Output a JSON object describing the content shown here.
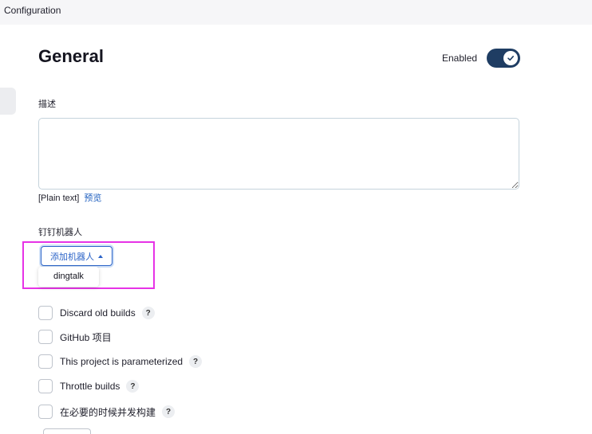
{
  "header": {
    "title": "Configuration"
  },
  "section": {
    "title": "General",
    "enabled_label": "Enabled",
    "enabled": true
  },
  "description": {
    "label": "描述",
    "value": "",
    "plain_text": "[Plain text]",
    "preview_link": "预览"
  },
  "dingtalk": {
    "label": "钉钉机器人",
    "add_button": "添加机器人",
    "dropdown_items": [
      "dingtalk"
    ]
  },
  "options": [
    {
      "label": "Discard old builds",
      "checked": false,
      "help": true
    },
    {
      "label": "GitHub 项目",
      "checked": false,
      "help": false
    },
    {
      "label": "This project is parameterized",
      "checked": false,
      "help": true
    },
    {
      "label": "Throttle builds",
      "checked": false,
      "help": true
    },
    {
      "label": "在必要的时候并发构建",
      "checked": false,
      "help": true
    }
  ],
  "help_glyph": "?",
  "colors": {
    "accent": "#2c64c8",
    "toggle": "#1f3d63",
    "highlight": "#e633e6"
  }
}
